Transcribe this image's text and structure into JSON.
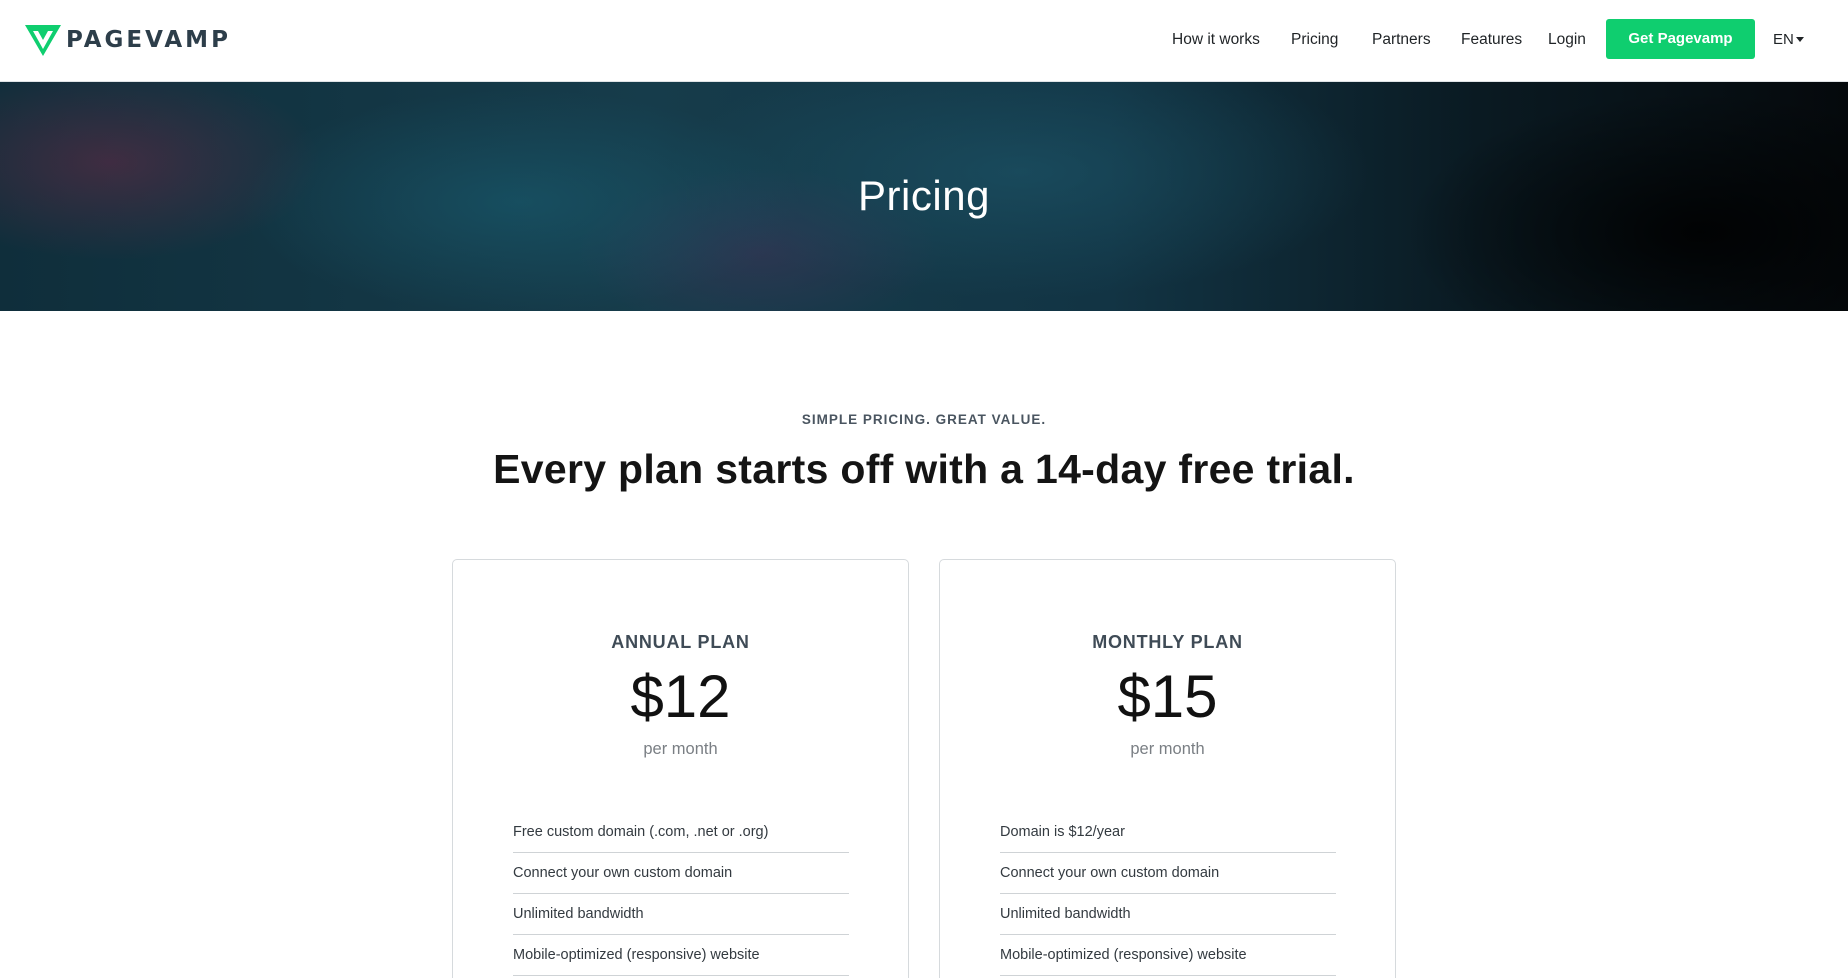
{
  "header": {
    "logo_text": "PAGEVAMP",
    "brand_color": "#0fce6f",
    "nav": [
      {
        "label": "How it works"
      },
      {
        "label": "Pricing"
      },
      {
        "label": "Partners"
      },
      {
        "label": "Features"
      },
      {
        "label": "Login"
      }
    ],
    "cta_label": "Get Pagevamp",
    "language": "EN"
  },
  "hero": {
    "title": "Pricing"
  },
  "pricing": {
    "eyebrow": "SIMPLE PRICING. GREAT VALUE.",
    "headline": "Every plan starts off with a 14-day free trial.",
    "plans": [
      {
        "name": "ANNUAL PLAN",
        "price": "$12",
        "period": "per month",
        "features": [
          "Free custom domain (.com, .net or .org)",
          "Connect your own custom domain",
          "Unlimited bandwidth",
          "Mobile-optimized (responsive) website"
        ]
      },
      {
        "name": "MONTHLY PLAN",
        "price": "$15",
        "period": "per month",
        "features": [
          "Domain is $12/year",
          "Connect your own custom domain",
          "Unlimited bandwidth",
          "Mobile-optimized (responsive) website"
        ]
      }
    ]
  }
}
